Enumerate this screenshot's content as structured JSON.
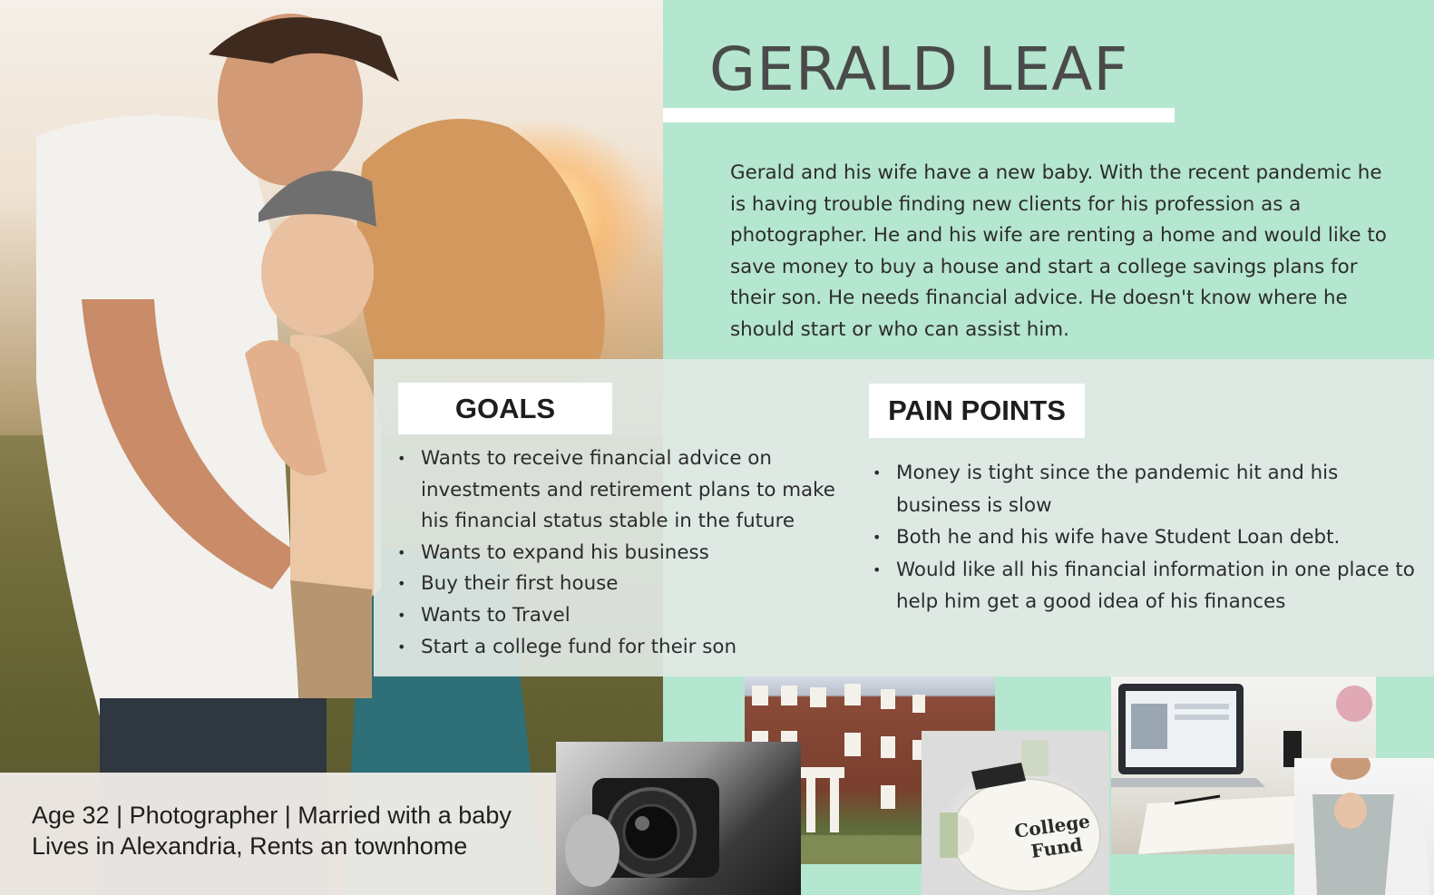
{
  "persona": {
    "name": "GERALD LEAF",
    "bio": "Gerald and his wife have a new baby. With the recent pandemic he is having trouble finding new clients for his profession as a photographer. He and his wife are renting a home and would like to save money to buy a house and start a college savings plans for their son. He needs financial advice. He doesn't know where he should start or who can assist him.",
    "info_line1": "Age 32 | Photographer | Married with a baby",
    "info_line2": "Lives in Alexandria, Rents an townhome"
  },
  "goals": {
    "label": "GOALS",
    "items": [
      "Wants to receive financial advice on investments and retirement plans to make his financial status stable in the future",
      "Wants to expand his business",
      "Buy their first  house",
      "Wants to Travel",
      "Start a college fund for their son"
    ]
  },
  "pain_points": {
    "label": "PAIN POINTS",
    "items": [
      "Money is tight since the pandemic hit and his business is slow",
      "Both he and his wife have Student Loan debt.",
      "Would like all his financial information in one place to help him get a good idea of his finances"
    ]
  },
  "collage": {
    "piggy_text_1": "College",
    "piggy_text_2": "Fund"
  },
  "colors": {
    "mint": "#b5e6cf",
    "panel": "#e1e8e4",
    "title": "#4a4a4a"
  }
}
